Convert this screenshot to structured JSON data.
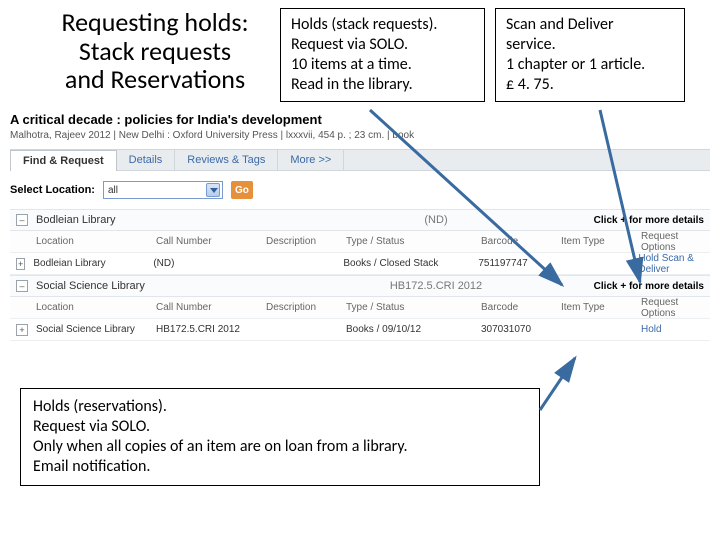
{
  "title": {
    "line1": "Requesting holds:",
    "line2": "Stack requests",
    "line3": "and Reservations"
  },
  "box_holds": {
    "l1": "Holds (stack requests).",
    "l2": "Request via SOLO.",
    "l3": "10 items at a time.",
    "l4": "Read in the library."
  },
  "box_scan": {
    "l1": "Scan and Deliver",
    "l2": "service.",
    "l3": "1 chapter or 1 article.",
    "l4": "£ 4. 75."
  },
  "box_reserve": {
    "l1": "Holds (reservations).",
    "l2": "Request via SOLO.",
    "l3": "Only when all copies of an item are on loan from a library.",
    "l4": "Email notification."
  },
  "cat": {
    "title": "A critical decade : policies for India's development",
    "meta": "Malhotra, Rajeev\n2012 | New Delhi : Oxford University Press | lxxxvii, 454 p. ; 23 cm. | book",
    "tabs": {
      "find": "Find & Request",
      "details": "Details",
      "reviews": "Reviews & Tags",
      "more": "More >>"
    },
    "filter_label": "Select Location:",
    "filter_value": "all",
    "go": "Go",
    "nd": "(ND)",
    "more_details": "Click + for more details",
    "cols": {
      "loc": "Location",
      "call": "Call Number",
      "desc": "Description",
      "type": "Type / Status",
      "bar": "Barcode",
      "itype": "Item Type",
      "req": "Request Options"
    },
    "lib1": {
      "name": "Bodleian Library",
      "row": {
        "loc": "Bodleian Library",
        "call": "(ND)",
        "desc": "",
        "type": "Books / Closed Stack",
        "bar": "751197747",
        "itype": "",
        "req": "Hold   Scan & Deliver"
      }
    },
    "lib2": {
      "name": "Social Science Library",
      "nd": "HB172.5.CRI 2012",
      "row": {
        "loc": "Social Science Library",
        "call": "HB172.5.CRI 2012",
        "desc": "",
        "type": "Books / 09/10/12",
        "bar": "307031070",
        "itype": "",
        "req": "Hold"
      }
    }
  }
}
